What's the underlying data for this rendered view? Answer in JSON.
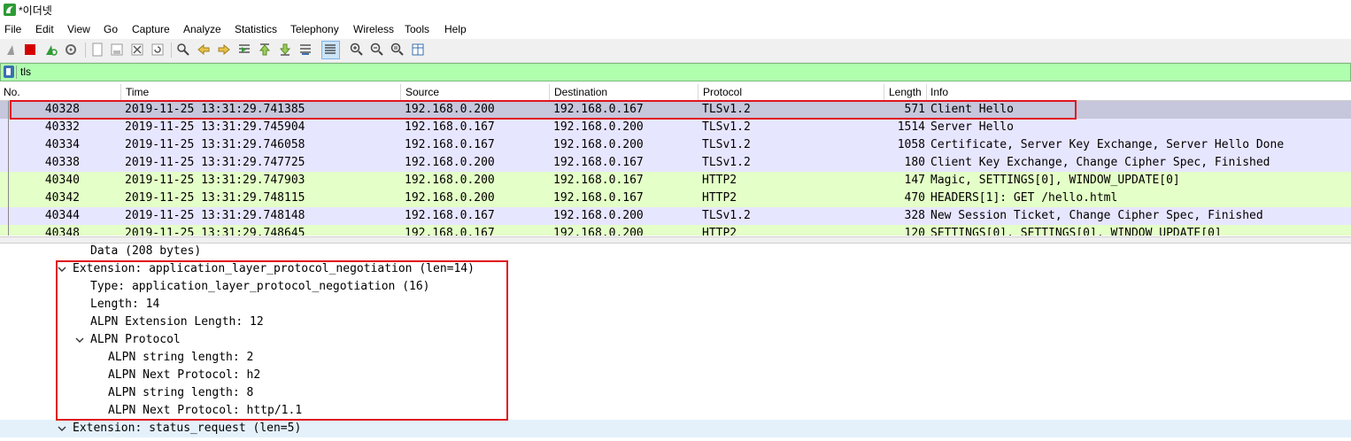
{
  "window": {
    "title": "*이더넷",
    "accent": "#2e9b35"
  },
  "menu": [
    "File",
    "Edit",
    "View",
    "Go",
    "Capture",
    "Analyze",
    "Statistics",
    "Telephony",
    "Wireless",
    "Tools",
    "Help"
  ],
  "toolbar": {
    "icons": [
      "shark-fin-icon",
      "stop-icon",
      "restart-icon",
      "options-gear-icon",
      "open-file-icon",
      "save-icon",
      "close-file-icon",
      "reload-icon",
      "find-icon",
      "back-icon",
      "forward-icon",
      "go-to-packet-icon",
      "first-packet-icon",
      "last-packet-icon",
      "autoscroll-icon",
      "colorize-icon",
      "zoom-in-icon",
      "zoom-out-icon",
      "zoom-reset-icon",
      "resize-columns-icon"
    ]
  },
  "filter": {
    "value": "tls",
    "bg": "#afffaf"
  },
  "columns": [
    "No.",
    "Time",
    "Source",
    "Destination",
    "Protocol",
    "Length",
    "Info"
  ],
  "packets": [
    {
      "no": "40328",
      "time": "2019-11-25 13:31:29.741385",
      "src": "192.168.0.200",
      "dst": "192.168.0.167",
      "proto": "TLSv1.2",
      "len": "571",
      "info": "Client Hello",
      "bg": "#c6c6dc"
    },
    {
      "no": "40332",
      "time": "2019-11-25 13:31:29.745904",
      "src": "192.168.0.167",
      "dst": "192.168.0.200",
      "proto": "TLSv1.2",
      "len": "1514",
      "info": "Server Hello",
      "bg": "#e7e6ff"
    },
    {
      "no": "40334",
      "time": "2019-11-25 13:31:29.746058",
      "src": "192.168.0.167",
      "dst": "192.168.0.200",
      "proto": "TLSv1.2",
      "len": "1058",
      "info": "Certificate, Server Key Exchange, Server Hello Done",
      "bg": "#e7e6ff"
    },
    {
      "no": "40338",
      "time": "2019-11-25 13:31:29.747725",
      "src": "192.168.0.200",
      "dst": "192.168.0.167",
      "proto": "TLSv1.2",
      "len": "180",
      "info": "Client Key Exchange, Change Cipher Spec, Finished",
      "bg": "#e7e6ff"
    },
    {
      "no": "40340",
      "time": "2019-11-25 13:31:29.747903",
      "src": "192.168.0.200",
      "dst": "192.168.0.167",
      "proto": "HTTP2",
      "len": "147",
      "info": "Magic, SETTINGS[0], WINDOW_UPDATE[0]",
      "bg": "#e4ffc7"
    },
    {
      "no": "40342",
      "time": "2019-11-25 13:31:29.748115",
      "src": "192.168.0.200",
      "dst": "192.168.0.167",
      "proto": "HTTP2",
      "len": "470",
      "info": "HEADERS[1]: GET /hello.html",
      "bg": "#e4ffc7"
    },
    {
      "no": "40344",
      "time": "2019-11-25 13:31:29.748148",
      "src": "192.168.0.167",
      "dst": "192.168.0.200",
      "proto": "TLSv1.2",
      "len": "328",
      "info": "New Session Ticket, Change Cipher Spec, Finished",
      "bg": "#e7e6ff"
    },
    {
      "no": "40348",
      "time": "2019-11-25 13:31:29.748645",
      "src": "192.168.0.167",
      "dst": "192.168.0.200",
      "proto": "HTTP2",
      "len": "120",
      "info": "SETTINGS[0], SETTINGS[0], WINDOW_UPDATE[0]",
      "bg": "#e4ffc7"
    }
  ],
  "details": [
    {
      "text": "Data (208 bytes)",
      "level": 2,
      "chevron": false
    },
    {
      "text": "Extension: application_layer_protocol_negotiation (len=14)",
      "level": 1,
      "chevron": true
    },
    {
      "text": "Type: application_layer_protocol_negotiation (16)",
      "level": 2,
      "chevron": false
    },
    {
      "text": "Length: 14",
      "level": 2,
      "chevron": false
    },
    {
      "text": "ALPN Extension Length: 12",
      "level": 2,
      "chevron": false
    },
    {
      "text": "ALPN Protocol",
      "level": 2,
      "chevron": true
    },
    {
      "text": "ALPN string length: 2",
      "level": 3,
      "chevron": false
    },
    {
      "text": "ALPN Next Protocol: h2",
      "level": 3,
      "chevron": false
    },
    {
      "text": "ALPN string length: 8",
      "level": 3,
      "chevron": false
    },
    {
      "text": "ALPN Next Protocol: http/1.1",
      "level": 3,
      "chevron": false
    },
    {
      "text": "Extension: status_request (len=5)",
      "level": 1,
      "chevron": true
    }
  ],
  "highlight_color": "#e0141e"
}
